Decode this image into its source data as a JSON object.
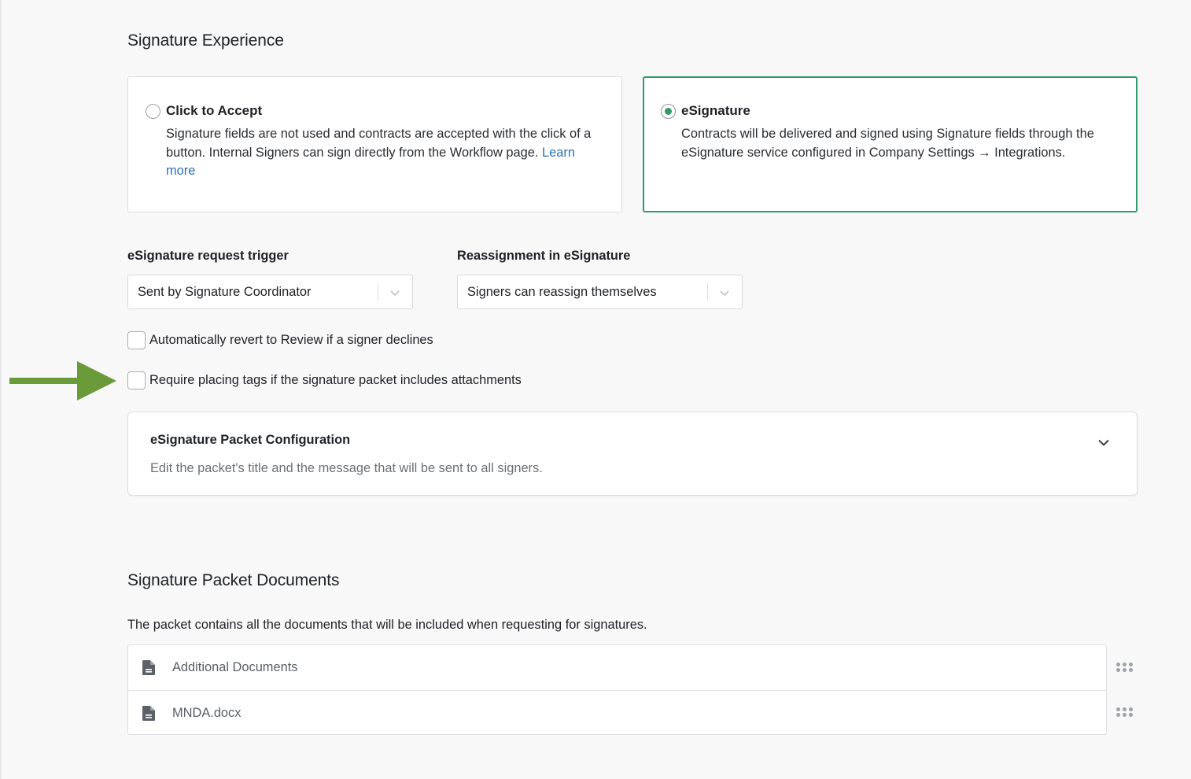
{
  "signature_experience": {
    "title": "Signature Experience",
    "options": [
      {
        "title": "Click to Accept",
        "description": "Signature fields are not used and contracts are accepted with the click of a button. Internal Signers can sign directly from the Workflow page.",
        "link_text": "Learn more",
        "selected": false
      },
      {
        "title": "eSignature",
        "description": "Contracts will be delivered and signed using Signature fields through the eSignature service configured in Company Settings → Integrations.",
        "selected": true
      }
    ]
  },
  "fields": {
    "trigger": {
      "label": "eSignature request trigger",
      "value": "Sent by Signature Coordinator"
    },
    "reassignment": {
      "label": "Reassignment in eSignature",
      "value": "Signers can reassign themselves"
    }
  },
  "checkboxes": [
    {
      "label": "Automatically revert to Review if a signer declines",
      "checked": false
    },
    {
      "label": "Require placing tags if the signature packet includes attachments",
      "checked": false
    }
  ],
  "packet_config": {
    "title": "eSignature Packet Configuration",
    "description": "Edit the packet's title and the message that will be sent to all signers."
  },
  "packet_documents": {
    "title": "Signature Packet Documents",
    "description": "The packet contains all the documents that will be included when requesting for signatures.",
    "documents": [
      {
        "name": "Additional Documents",
        "icon": "file-icon"
      },
      {
        "name": "MNDA.docx",
        "icon": "file-icon"
      }
    ]
  },
  "colors": {
    "accent_green": "#2f9a6a",
    "link_blue": "#2a6fb5",
    "arrow_green": "#6b9a3a"
  }
}
